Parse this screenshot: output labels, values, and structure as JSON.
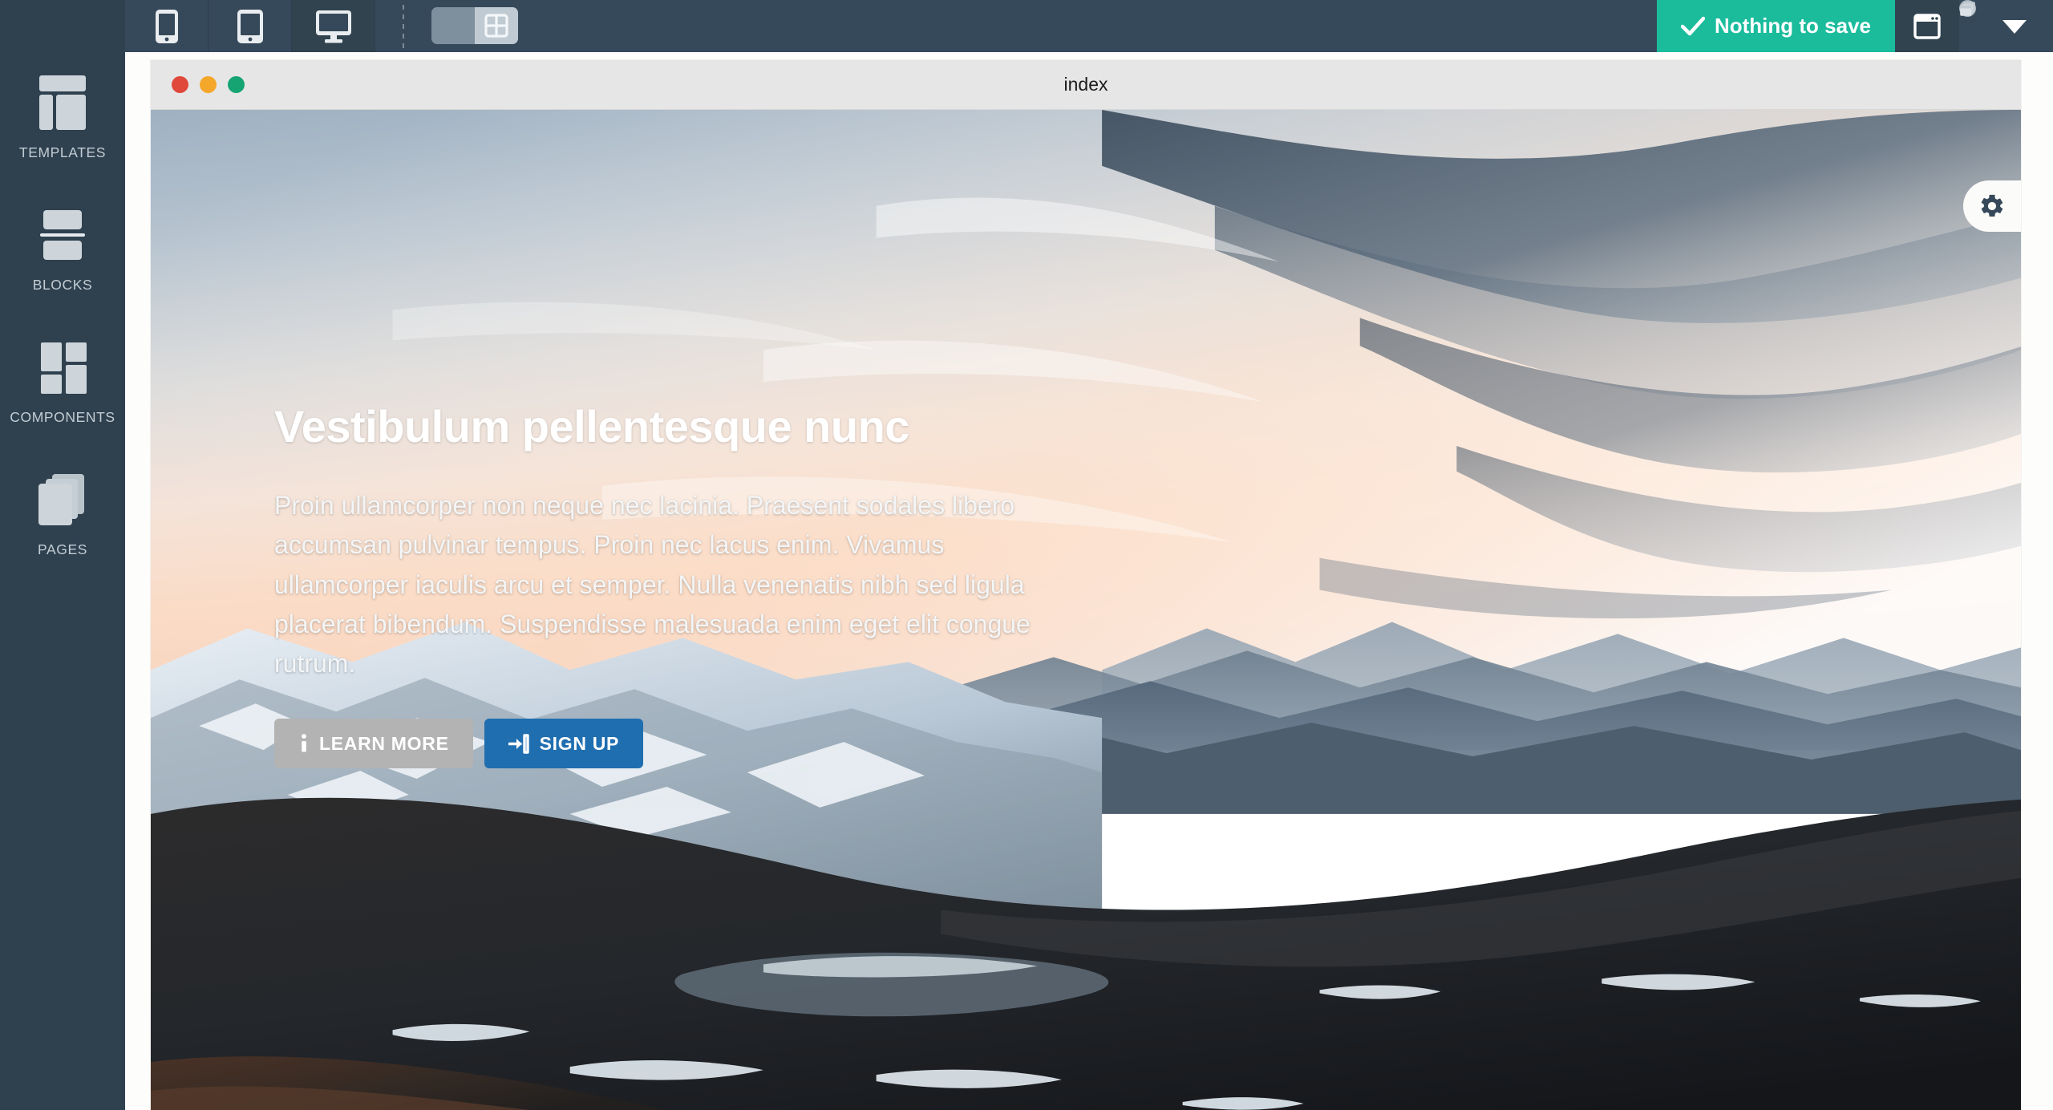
{
  "topbar": {
    "devices": [
      {
        "name": "mobile",
        "label": "Mobile view",
        "active": false
      },
      {
        "name": "tablet",
        "label": "Tablet view",
        "active": false
      },
      {
        "name": "desktop",
        "label": "Desktop view",
        "active": true
      }
    ],
    "grid_toggle": {
      "icon": "grid-icon",
      "state": "on"
    },
    "save_status": "Nothing to save",
    "save_icon": "check-icon",
    "save_color": "#1abc9c",
    "window_icon": "single-window-icon",
    "windows_icon": "multi-window-icon",
    "caret_icon": "chevron-down-icon"
  },
  "sidebar": {
    "items": [
      {
        "label": "TEMPLATES",
        "icon": "templates-layout-icon"
      },
      {
        "label": "BLOCKS",
        "icon": "blocks-stack-icon"
      },
      {
        "label": "COMPONENTS",
        "icon": "components-mosaic-icon"
      },
      {
        "label": "PAGES",
        "icon": "pages-sheets-icon"
      }
    ],
    "bg_color": "#2f414f"
  },
  "browser": {
    "title": "index",
    "traffic_lights": [
      {
        "name": "close",
        "color": "#e0483b"
      },
      {
        "name": "minimize",
        "color": "#f4a72a"
      },
      {
        "name": "zoom",
        "color": "#16a473"
      }
    ]
  },
  "hero": {
    "heading": "Vestibulum pellentesque nunc",
    "paragraph": "Proin ullamcorper non neque nec lacinia. Praesent sodales libero accumsan pulvinar tempus. Proin nec lacus enim. Vivamus ullamcorper iaculis arcu et semper. Nulla venenatis nibh sed ligula placerat bibendum. Suspendisse malesuada enim eget elit congue rutrum.",
    "buttons": [
      {
        "label": "LEARN MORE",
        "icon": "info-icon",
        "style": "secondary",
        "color": "#b3b3b3"
      },
      {
        "label": "SIGN UP",
        "icon": "sign-in-icon",
        "style": "primary",
        "color": "#1f6eb0"
      }
    ],
    "settings_icon": "gear-icon"
  }
}
